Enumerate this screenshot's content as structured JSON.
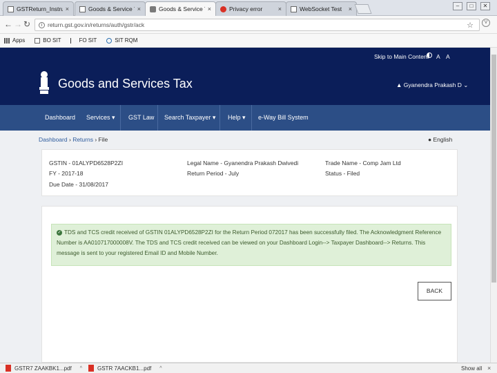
{
  "browser": {
    "tabs": [
      {
        "label": "GSTReturn_Instruction - Ag",
        "icon": "doc-icon"
      },
      {
        "label": "Goods & Service Tax (GS",
        "icon": "doc-icon"
      },
      {
        "label": "Goods & Service Tax (GS",
        "icon": "gst-icon",
        "active": true
      },
      {
        "label": "Privacy error",
        "icon": "warning-icon"
      },
      {
        "label": "WebSocket Test",
        "icon": "doc-icon"
      }
    ],
    "tab_close": "×",
    "window_controls": {
      "minimize": "–",
      "maximize": "□",
      "close": "✕"
    },
    "url": "return.gst.gov.in/returns/auth/gstr/ack",
    "bookmarks": [
      {
        "label": "Apps",
        "icon": "apps-grid-icon"
      },
      {
        "label": "BO SIT",
        "icon": "page-icon"
      },
      {
        "label": "FO SIT",
        "icon": "flag-icon"
      },
      {
        "label": "SIT RQM",
        "icon": "globe-icon"
      }
    ]
  },
  "site": {
    "skip_link": "Skip to Main Content",
    "font_small": "A",
    "font_large": "A",
    "title": "Goods and Services Tax",
    "user": "Gyanendra Prakash D",
    "nav": [
      {
        "label": "Dashboard"
      },
      {
        "label": "Services ▾"
      },
      {
        "label": "GST Law"
      },
      {
        "label": "Search Taxpayer ▾"
      },
      {
        "label": "Help ▾"
      },
      {
        "label": "e-Way Bill System"
      }
    ]
  },
  "breadcrumb": {
    "dashboard": "Dashboard",
    "sep1": "›",
    "returns": "Returns",
    "sep2": "›",
    "current": "File"
  },
  "language": "English",
  "details": {
    "gstin": "GSTIN - 01ALYPD6528P2ZI",
    "fy": "FY - 2017-18",
    "due_date": "Due Date - 31/08/2017",
    "legal_name": "Legal Name - Gyanendra Prakash Dwivedi",
    "return_period": "Return Period - July",
    "trade_name": "Trade Name - Comp Jam Ltd",
    "status": "Status - Filed"
  },
  "alert": {
    "line1": "TDS and TCS credit received of GSTIN 01ALYPD6528P2ZI for the Return Period 072017 has been successfully filed. The Acknowledgment Reference",
    "line2": "Number is AA010717000008V. The TDS and TCS credit received can be viewed on your Dashboard Login--> Taxpayer Dashboard--> Returns. This",
    "line3": "message is sent to your registered Email ID and Mobile Number."
  },
  "back_button": "BACK",
  "downloads": {
    "items": [
      {
        "label": "GSTR7 ZAAKBK1...pdf"
      },
      {
        "label": "GSTR 7AACKB1...pdf"
      }
    ],
    "caret": "^",
    "show_all": "Show all",
    "close": "×"
  }
}
